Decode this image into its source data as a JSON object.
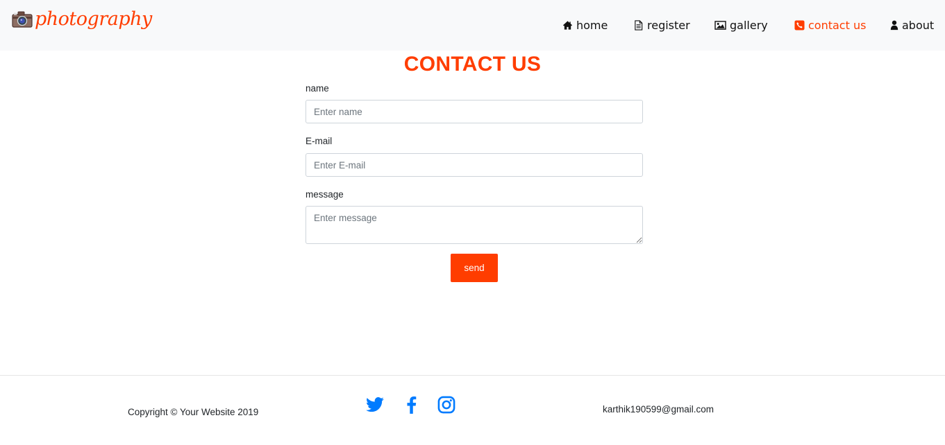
{
  "brand": {
    "name": "photography",
    "logo_icon": "camera-icon"
  },
  "nav": {
    "items": [
      {
        "label": "home",
        "icon": "home-icon"
      },
      {
        "label": "register",
        "icon": "document-icon"
      },
      {
        "label": "gallery",
        "icon": "image-icon"
      },
      {
        "label": "contact us",
        "icon": "phone-icon",
        "active": true
      },
      {
        "label": "about",
        "icon": "user-icon"
      }
    ]
  },
  "page": {
    "title": "CONTACT US"
  },
  "form": {
    "name": {
      "label": "name",
      "placeholder": "Enter name",
      "value": ""
    },
    "email": {
      "label": "E-mail",
      "placeholder": "Enter E-mail",
      "value": ""
    },
    "message": {
      "label": "message",
      "placeholder": "Enter message",
      "value": ""
    },
    "submit_label": "send"
  },
  "footer": {
    "copyright": "Copyright © Your Website 2019",
    "social": [
      "twitter-icon",
      "facebook-icon",
      "instagram-icon"
    ],
    "email": "karthik190599@gmail.com"
  },
  "colors": {
    "accent": "#ff3d00",
    "social": "#007bff",
    "navbar_bg": "#f8f9fa"
  }
}
